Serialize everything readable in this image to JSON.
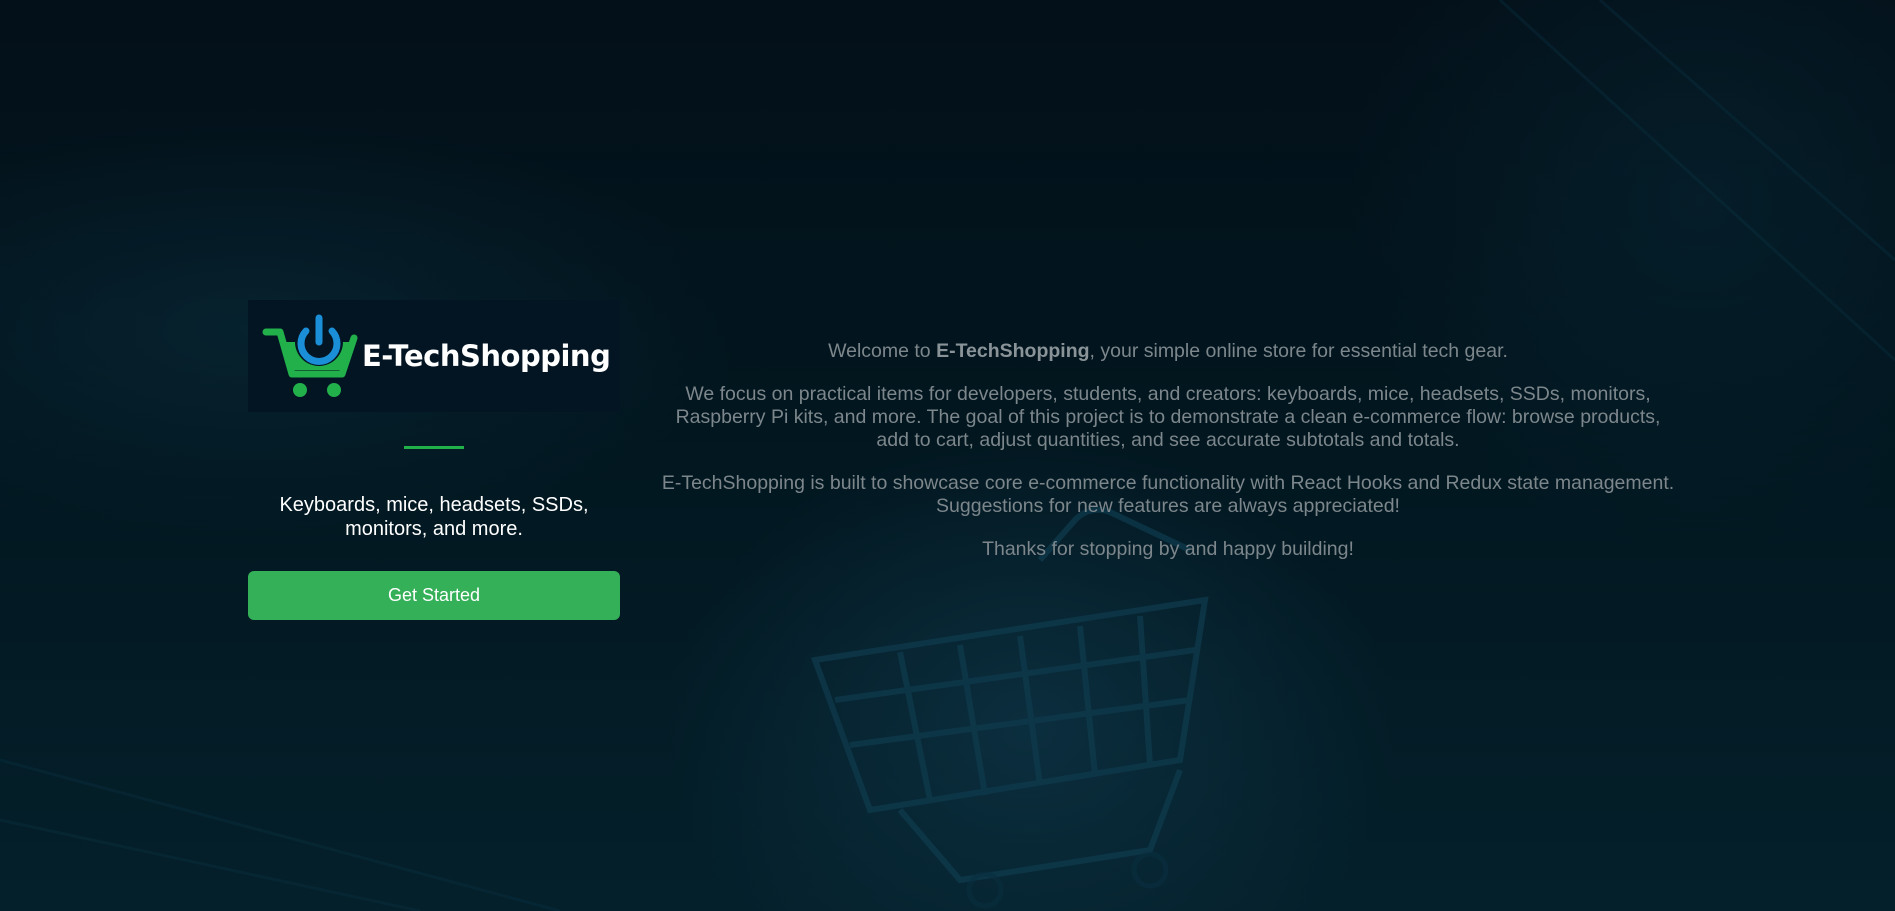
{
  "brand": {
    "name": "E-TechShopping",
    "colors": {
      "accent_green": "#33b058",
      "icon_blue": "#1a8fd8",
      "background": "#02141c"
    }
  },
  "hero": {
    "tagline": "Keyboards, mice, headsets, SSDs, monitors, and more.",
    "cta_label": "Get Started"
  },
  "about": {
    "welcome_prefix": "Welcome to ",
    "welcome_brand": "E-TechShopping",
    "welcome_suffix": ", your simple online store for essential tech gear.",
    "paragraph_focus": "We focus on practical items for developers, students, and creators: keyboards, mice, headsets, SSDs, monitors, Raspberry Pi kits, and more. The goal of this project is to demonstrate a clean e-commerce flow: browse products, add to cart, adjust quantities, and see accurate subtotals and totals.",
    "paragraph_tech": "E-TechShopping is built to showcase core e-commerce functionality with React Hooks and Redux state management. Suggestions for new features are always appreciated!",
    "paragraph_thanks": "Thanks for stopping by and happy building!"
  }
}
